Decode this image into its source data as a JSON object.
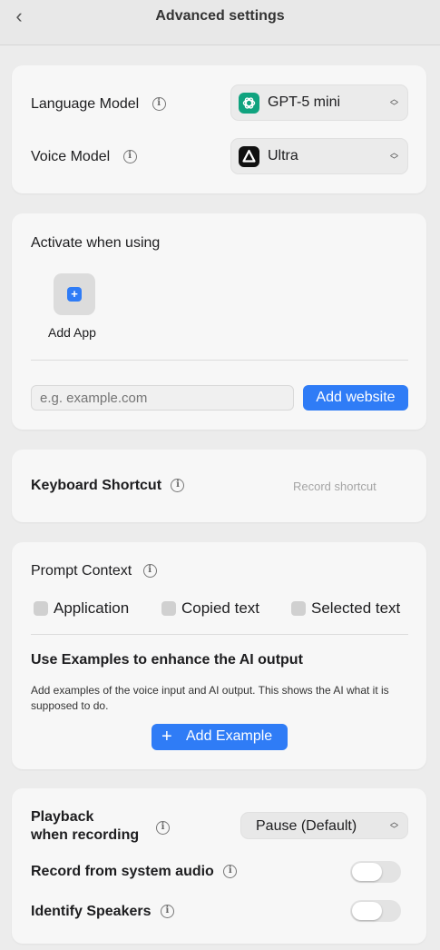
{
  "header": {
    "title": "Advanced settings"
  },
  "models": {
    "language_label": "Language Model",
    "language_value": "GPT-5 mini",
    "voice_label": "Voice Model",
    "voice_value": "Ultra"
  },
  "activate": {
    "heading": "Activate when using",
    "add_app_label": "Add App",
    "website_placeholder": "e.g. example.com",
    "add_website_label": "Add website"
  },
  "shortcut": {
    "label": "Keyboard Shortcut",
    "record_label": "Record shortcut"
  },
  "context": {
    "heading": "Prompt Context",
    "options": [
      "Application",
      "Copied text",
      "Selected text"
    ],
    "examples_heading": "Use Examples to enhance the AI output",
    "examples_description": "Add examples of the voice input and AI output. This shows the AI what it is supposed to do.",
    "add_example_label": "Add Example"
  },
  "playback": {
    "label_line1": "Playback",
    "label_line2": "when recording",
    "value": "Pause (Default)",
    "system_audio_label": "Record from system audio",
    "system_audio_on": false,
    "identify_speakers_label": "Identify Speakers",
    "identify_speakers_on": false
  },
  "colors": {
    "accent": "#2f7cf6",
    "openai_green": "#10a37f",
    "card": "#f7f7f7",
    "background": "#ececec"
  },
  "icons": {
    "info": "ⓘ",
    "back": "chevron-left-icon",
    "openai": "openai-icon",
    "ultra": "triangle-icon",
    "plus": "plus-icon"
  }
}
